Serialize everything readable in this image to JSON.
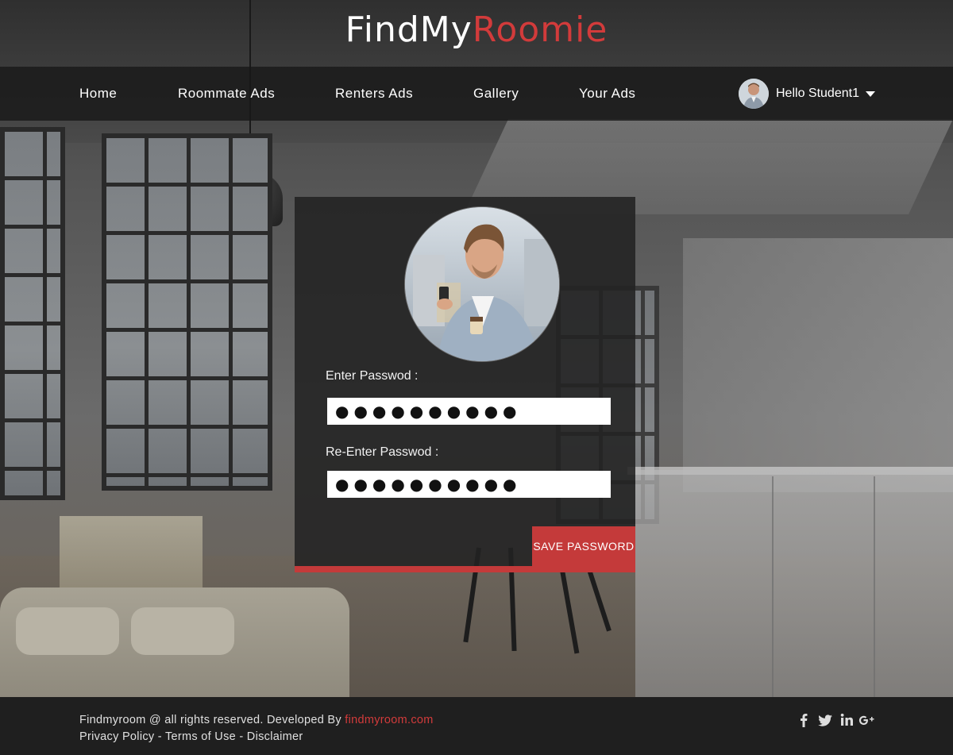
{
  "brand": {
    "part1": "FindMy",
    "part2": "Roomie"
  },
  "nav": {
    "items": [
      {
        "label": "Home"
      },
      {
        "label": "Roommate Ads"
      },
      {
        "label": "Renters Ads"
      },
      {
        "label": "Gallery"
      },
      {
        "label": "Your Ads"
      }
    ],
    "user_greeting": "Hello Student1"
  },
  "form": {
    "password_label": "Enter Passwod :",
    "password_value": "●●●●●●●●●●",
    "reenter_label": "Re-Enter Passwod :",
    "reenter_value": "●●●●●●●●●●",
    "save_label": "SAVE PASSWORD"
  },
  "footer": {
    "copyright_prefix": "Findmyroom @ all rights reserved. Developed By ",
    "developer_link": "findmyroom.com",
    "privacy": "Privacy Policy",
    "separator": " - ",
    "terms": "Terms of Use",
    "disclaimer": "Disclaimer",
    "social_icons": [
      "facebook-icon",
      "twitter-icon",
      "linkedin-icon",
      "googleplus-icon"
    ]
  },
  "colors": {
    "accent": "#c43a3a",
    "navbar": "#191919",
    "footer": "#1f1f1f"
  }
}
